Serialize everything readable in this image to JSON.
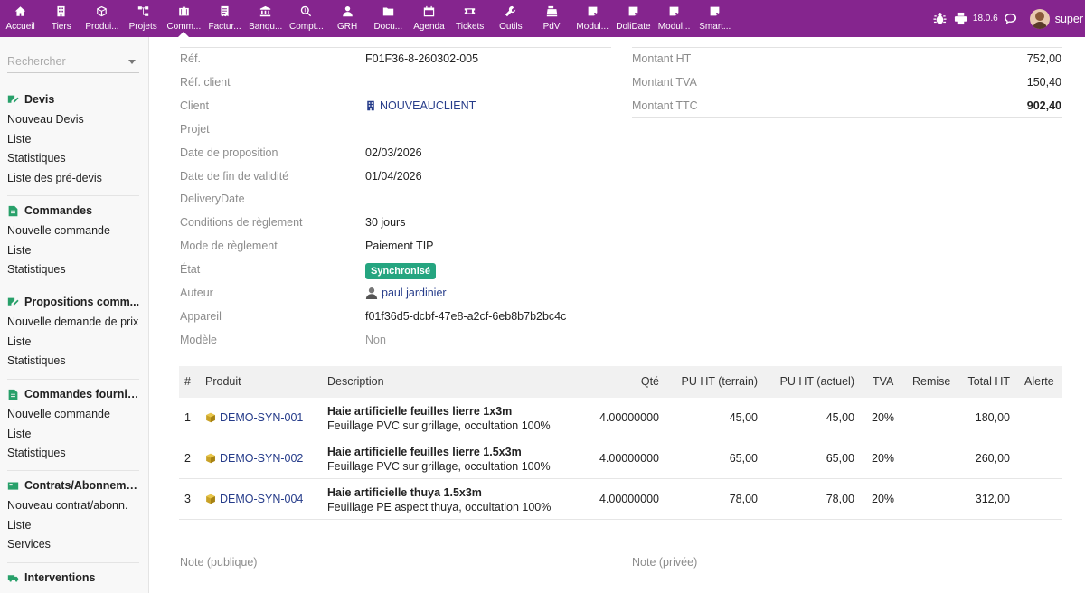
{
  "topbar": {
    "menu": [
      {
        "label": "Accueil",
        "icon": "home-icon"
      },
      {
        "label": "Tiers",
        "icon": "building-icon"
      },
      {
        "label": "Produi...",
        "icon": "cube-icon"
      },
      {
        "label": "Projets",
        "icon": "sitemap-icon"
      },
      {
        "label": "Comm...",
        "icon": "briefcase-icon"
      },
      {
        "label": "Factur...",
        "icon": "invoice-icon"
      },
      {
        "label": "Banqu...",
        "icon": "bank-icon"
      },
      {
        "label": "Compt...",
        "icon": "search-dollar-icon"
      },
      {
        "label": "GRH",
        "icon": "user-icon"
      },
      {
        "label": "Docu...",
        "icon": "folder-icon"
      },
      {
        "label": "Agenda",
        "icon": "calendar-icon"
      },
      {
        "label": "Tickets",
        "icon": "ticket-icon"
      },
      {
        "label": "Outils",
        "icon": "wrench-icon"
      },
      {
        "label": "PdV",
        "icon": "cash-register-icon"
      },
      {
        "label": "Modul...",
        "icon": "note-icon"
      },
      {
        "label": "DoliDate",
        "icon": "note-icon"
      },
      {
        "label": "Modul...",
        "icon": "note-icon"
      },
      {
        "label": "Smart...",
        "icon": "note-icon"
      }
    ],
    "active_index": 4,
    "version": "18.0.6",
    "username": "super"
  },
  "sidebar": {
    "search_placeholder": "Rechercher",
    "sections": [
      {
        "title": "Devis",
        "icon": "quote-icon",
        "items": [
          "Nouveau Devis",
          "Liste",
          "Statistiques",
          "Liste des pré-devis"
        ]
      },
      {
        "title": "Commandes",
        "icon": "order-icon",
        "items": [
          "Nouvelle commande",
          "Liste",
          "Statistiques"
        ]
      },
      {
        "title": "Propositions comm...",
        "icon": "proposal-icon",
        "items": [
          "Nouvelle demande de prix",
          "Liste",
          "Statistiques"
        ]
      },
      {
        "title": "Commandes fournis...",
        "icon": "supplier-order-icon",
        "items": [
          "Nouvelle commande",
          "Liste",
          "Statistiques"
        ]
      },
      {
        "title": "Contrats/Abonneme...",
        "icon": "contract-icon",
        "items": [
          "Nouveau contrat/abonn.",
          "Liste",
          "Services"
        ]
      },
      {
        "title": "Interventions",
        "icon": "intervention-icon",
        "items": []
      }
    ]
  },
  "details": {
    "fields": [
      {
        "label": "Réf.",
        "value": "F01F36-8-260302-005"
      },
      {
        "label": "Réf. client",
        "value": ""
      },
      {
        "label": "Client",
        "value": "NOUVEAUCLIENT"
      },
      {
        "label": "Projet",
        "value": ""
      },
      {
        "label": "Date de proposition",
        "value": "02/03/2026"
      },
      {
        "label": "Date de fin de validité",
        "value": "01/04/2026"
      },
      {
        "label": "DeliveryDate",
        "value": ""
      },
      {
        "label": "Conditions de règlement",
        "value": "30 jours"
      },
      {
        "label": "Mode de règlement",
        "value": "Paiement TIP"
      },
      {
        "label": "État",
        "value": "Synchronisé"
      },
      {
        "label": "Auteur",
        "value": "paul jardinier"
      },
      {
        "label": "Appareil",
        "value": "f01f36d5-dcbf-47e8-a2cf-6eb8b7b2bc4c"
      },
      {
        "label": "Modèle",
        "value": "Non"
      }
    ],
    "status_color": "#25a580"
  },
  "amounts": [
    {
      "label": "Montant HT",
      "value": "752,00"
    },
    {
      "label": "Montant TVA",
      "value": "150,40"
    },
    {
      "label": "Montant TTC",
      "value": "902,40"
    }
  ],
  "lines": {
    "headers": [
      "#",
      "Produit",
      "Description",
      "Qté",
      "PU HT (terrain)",
      "PU HT (actuel)",
      "TVA",
      "Remise",
      "Total HT",
      "Alerte"
    ],
    "rows": [
      {
        "num": "1",
        "product": "DEMO-SYN-001",
        "desc_title": "Haie artificielle feuilles lierre 1x3m",
        "desc_sub": "Feuillage PVC sur grillage, occultation 100%",
        "qty": "4.00000000",
        "pu_terrain": "45,00",
        "pu_actuel": "45,00",
        "tva": "20%",
        "remise": "",
        "total": "180,00",
        "alerte": ""
      },
      {
        "num": "2",
        "product": "DEMO-SYN-002",
        "desc_title": "Haie artificielle feuilles lierre 1.5x3m",
        "desc_sub": "Feuillage PVC sur grillage, occultation 100%",
        "qty": "4.00000000",
        "pu_terrain": "65,00",
        "pu_actuel": "65,00",
        "tva": "20%",
        "remise": "",
        "total": "260,00",
        "alerte": ""
      },
      {
        "num": "3",
        "product": "DEMO-SYN-004",
        "desc_title": "Haie artificielle thuya 1.5x3m",
        "desc_sub": "Feuillage PE aspect thuya, occultation 100%",
        "qty": "4.00000000",
        "pu_terrain": "78,00",
        "pu_actuel": "78,00",
        "tva": "20%",
        "remise": "",
        "total": "312,00",
        "alerte": ""
      }
    ]
  },
  "notes": {
    "public_label": "Note (publique)",
    "private_label": "Note (privée)"
  }
}
